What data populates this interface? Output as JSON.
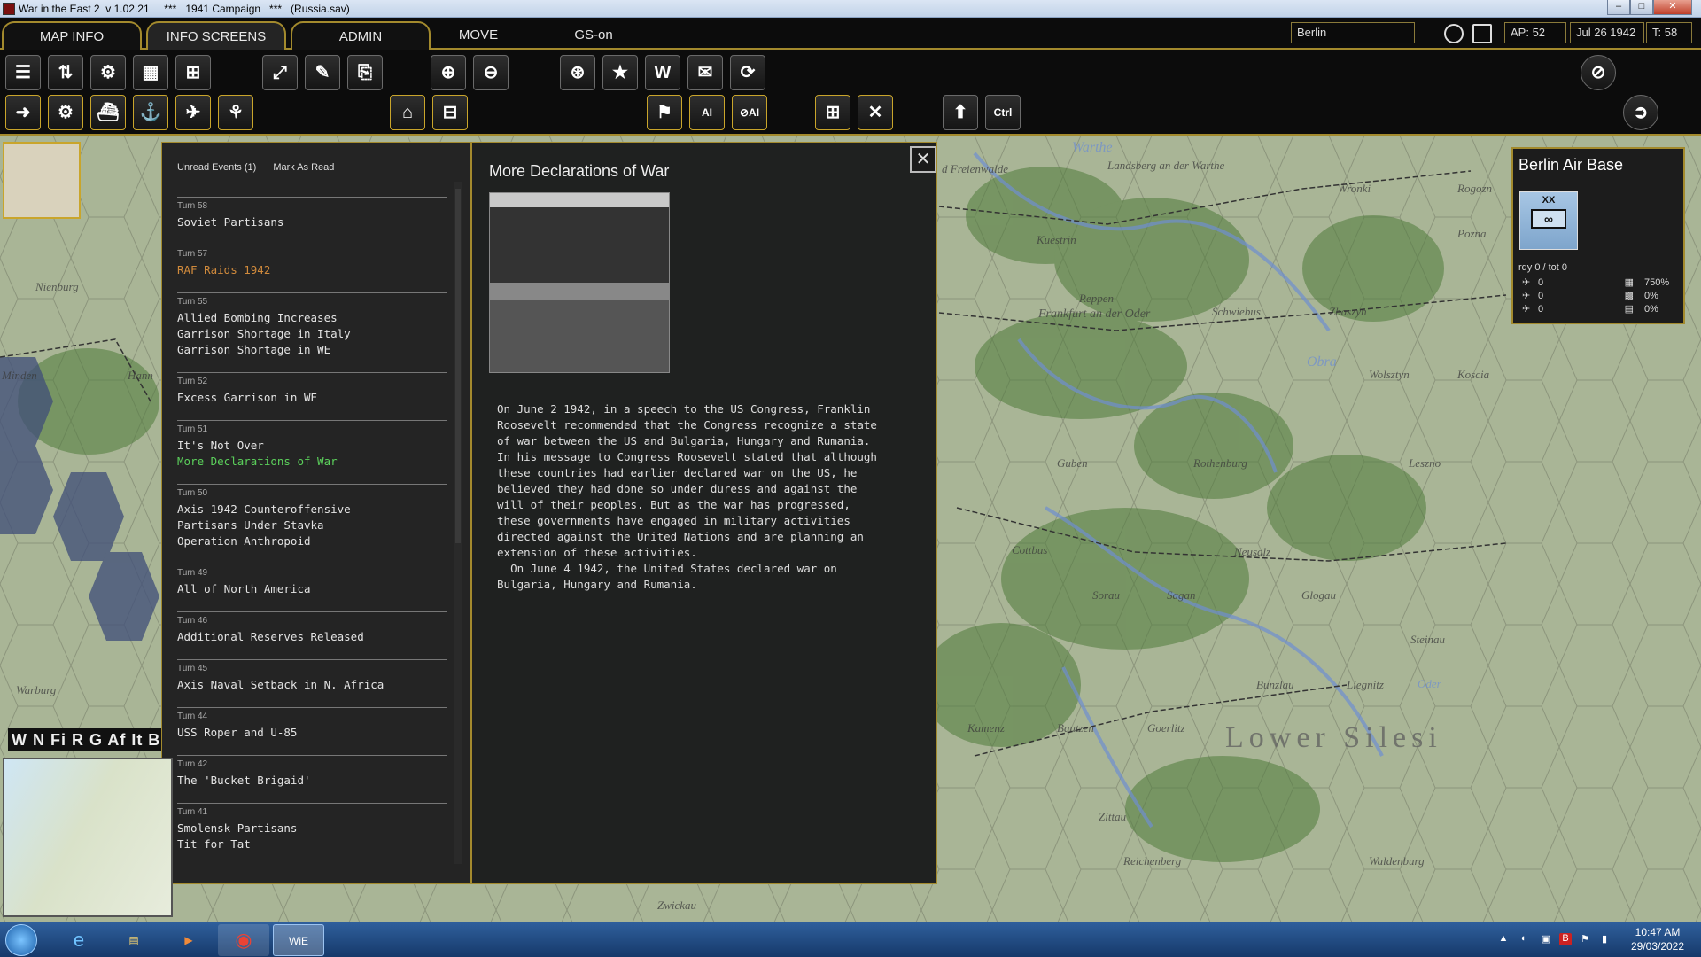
{
  "window": {
    "title": "War in the East 2  v 1.02.21     ***   1941 Campaign   ***   (Russia.sav)",
    "min": "–",
    "max": "□",
    "close": "✕"
  },
  "menu": {
    "tabs": [
      "MAP INFO",
      "INFO SCREENS",
      "ADMIN",
      "MOVE",
      "GS-on"
    ],
    "search_value": "Berlin",
    "ap": "AP: 52",
    "date": "Jul 26 1942",
    "turn": "T: 58"
  },
  "toolbar": {
    "row1": [
      "☰",
      "⇅",
      "⚙",
      "▦",
      "⊞",
      "⤢",
      "✎",
      "⎘",
      "⊕",
      "⊖",
      "⊛",
      "★",
      "W",
      "✉",
      "⟳",
      "⊘"
    ],
    "row2": [
      "➜",
      "⚙",
      "⛴",
      "⚓",
      "✈",
      "⚘",
      "⌂",
      "⊟",
      "⚑",
      "AI",
      "⊘AI",
      "⊞",
      "✕",
      "⬆",
      "Ctrl",
      "➲"
    ]
  },
  "events": {
    "header": {
      "unread": "Unread Events (1)",
      "mark": "Mark As Read"
    },
    "items": [
      {
        "turn": "Turn 58",
        "titles": [
          "Soviet Partisans"
        ],
        "style": "normal"
      },
      {
        "turn": "Turn 57",
        "titles": [
          "RAF Raids 1942"
        ],
        "style": "orange"
      },
      {
        "turn": "Turn 55",
        "titles": [
          "Allied Bombing Increases",
          "Garrison Shortage in Italy",
          "Garrison Shortage in WE"
        ],
        "style": "normal"
      },
      {
        "turn": "Turn 52",
        "titles": [
          "Excess Garrison in WE"
        ],
        "style": "normal"
      },
      {
        "turn": "Turn 51",
        "titles": [
          "It's Not Over",
          "More Declarations of War"
        ],
        "style": "mixed"
      },
      {
        "turn": "Turn 50",
        "titles": [
          "Axis 1942 Counteroffensive",
          "Partisans Under Stavka",
          "Operation Anthropoid"
        ],
        "style": "normal"
      },
      {
        "turn": "Turn 49",
        "titles": [
          "All of North America"
        ],
        "style": "normal"
      },
      {
        "turn": "Turn 46",
        "titles": [
          "Additional Reserves Released"
        ],
        "style": "normal"
      },
      {
        "turn": "Turn 45",
        "titles": [
          "Axis Naval Setback in N. Africa"
        ],
        "style": "normal"
      },
      {
        "turn": "Turn 44",
        "titles": [
          "USS Roper and U-85"
        ],
        "style": "normal"
      },
      {
        "turn": "Turn 42",
        "titles": [
          "The 'Bucket Brigaid'"
        ],
        "style": "normal"
      },
      {
        "turn": "Turn 41",
        "titles": [
          "Smolensk Partisans",
          "Tit for Tat"
        ],
        "style": "normal"
      }
    ]
  },
  "detail": {
    "title": "More Declarations of War",
    "body": "On June 2 1942, in a speech to the US Congress, Franklin\nRoosevelt recommended that the Congress recognize a state\nof war between the US and Bulgaria, Hungary and Rumania.\nIn his message to Congress Roosevelt stated that although\nthese countries had earlier declared war on the US, he\nbelieved they had done so under duress and against the\nwill of their peoples. But as the war has progressed,\nthese governments have engaged in military activities\ndirected against the United Nations and are planning an\nextension of these activities.\n  On June 4 1942, the United States declared war on\nBulgaria, Hungary and Rumania.",
    "close": "✕"
  },
  "minimap": {
    "filters": "W N Fi R G Af It B"
  },
  "base": {
    "title": "Berlin Air Base",
    "counter_size": "XX",
    "counter_symbol": "∞",
    "ready": "rdy 0 / tot 0",
    "rows": [
      {
        "icon": "✈",
        "value": "0",
        "icon2": "▦",
        "pct": "750%"
      },
      {
        "icon": "✈",
        "value": "0",
        "icon2": "▩",
        "pct": "0%"
      },
      {
        "icon": "✈",
        "value": "0",
        "icon2": "▤",
        "pct": "0%"
      }
    ]
  },
  "map_labels": [
    "d Freienwalde",
    "Landsberg an der Warthe",
    "Wronki",
    "Rogozn",
    "Kuestrin",
    "Pozna",
    "Reppen",
    "Frankfurt an der Oder",
    "Schwiebus",
    "Zbaszyn",
    "Wolsztyn",
    "Koscia",
    "Guben",
    "Rothenburg",
    "Leszno",
    "Neusalz",
    "Cottbus",
    "Sorau",
    "Sagan",
    "Glogau",
    "Steinau",
    "Bunzlau",
    "Liegnitz",
    "Kamenz",
    "Bautzen",
    "Goerlitz",
    "Lower Silesi",
    "Zittau",
    "Reichenberg",
    "Waldenburg",
    "Zwickau",
    "Nienburg",
    "Minden",
    "Hann",
    "Warburg",
    "Oder",
    "Obra",
    "Warthe"
  ],
  "taskbar": {
    "time": "10:47 AM",
    "date": "29/03/2022",
    "apps": [
      "e",
      "▤",
      "▶",
      "◉",
      "WiE"
    ]
  }
}
